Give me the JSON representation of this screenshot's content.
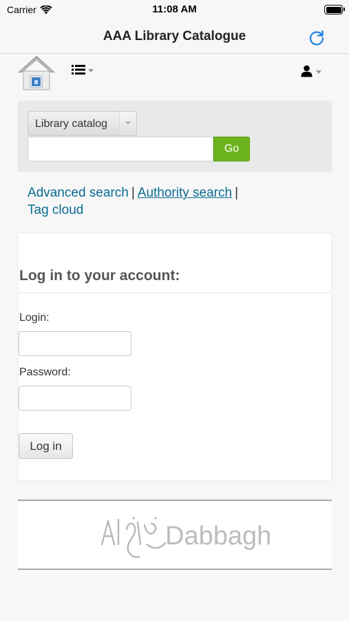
{
  "status_bar": {
    "carrier": "Carrier",
    "time": "11:08 AM"
  },
  "nav_bar": {
    "title": "AAA Library Catalogue"
  },
  "search": {
    "catalog_select": "Library catalog",
    "query_value": "",
    "go_label": "Go"
  },
  "links": {
    "advanced_search": "Advanced search",
    "authority_search": "Authority search",
    "tag_cloud": "Tag cloud",
    "separator": "|"
  },
  "login": {
    "heading": "Log in to your account:",
    "login_label": "Login:",
    "login_value": "",
    "password_label": "Password:",
    "password_value": "",
    "submit_label": "Log in"
  },
  "footer": {
    "logo_text": "AlDabbagh"
  },
  "colors": {
    "link": "#0a6b90",
    "go_button": "#6cb31b",
    "refresh_icon": "#1a7ee6"
  },
  "icons": [
    "wifi-icon",
    "battery-icon",
    "refresh-icon",
    "home-icon",
    "list-icon",
    "user-icon",
    "caret-down-icon"
  ]
}
